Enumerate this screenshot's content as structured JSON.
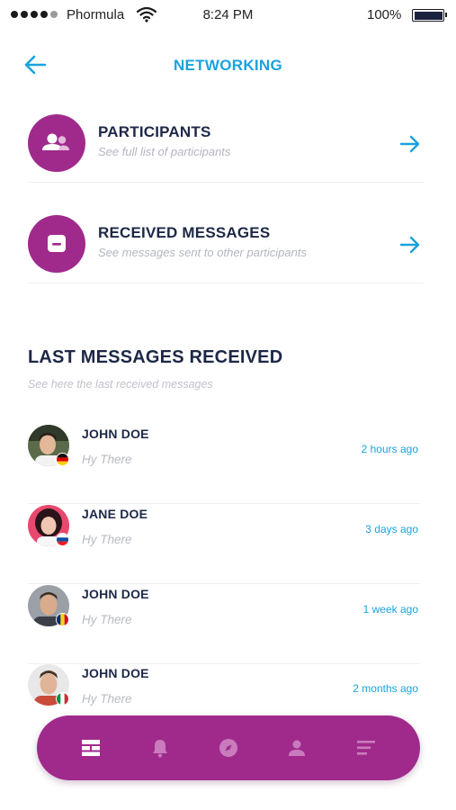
{
  "status_bar": {
    "carrier": "Phormula",
    "time": "8:24 PM",
    "battery": "100%"
  },
  "header": {
    "title": "NETWORKING",
    "back_icon": "arrow-left-icon"
  },
  "menu": [
    {
      "title": "PARTICIPANTS",
      "subtitle": "See full list of participants",
      "icon": "people-icon"
    },
    {
      "title": "RECEIVED MESSAGES",
      "subtitle": "See messages sent to other participants",
      "icon": "message-icon"
    }
  ],
  "last_messages": {
    "title": "LAST MESSAGES RECEIVED",
    "subtitle": "See here the last received messages",
    "items": [
      {
        "name": "JOHN DOE",
        "text": "Hy There",
        "time": "2 hours ago",
        "flag": "germany-flag"
      },
      {
        "name": "JANE DOE",
        "text": "Hy There",
        "time": "3 days ago",
        "flag": "slovakia-flag"
      },
      {
        "name": "JOHN DOE",
        "text": "Hy There",
        "time": "1 week ago",
        "flag": "romania-flag"
      },
      {
        "name": "JOHN DOE",
        "text": "Hy There",
        "time": "2 months ago",
        "flag": "italy-flag"
      }
    ]
  },
  "bottom_nav": {
    "items": [
      "dashboard-icon",
      "bell-icon",
      "compass-icon",
      "user-icon",
      "menu-icon"
    ],
    "active": "dashboard-icon"
  },
  "colors": {
    "accent": "#1aa3dc",
    "brand": "#a02a8c",
    "text": "#1d2847",
    "muted": "#b8bbc4"
  }
}
